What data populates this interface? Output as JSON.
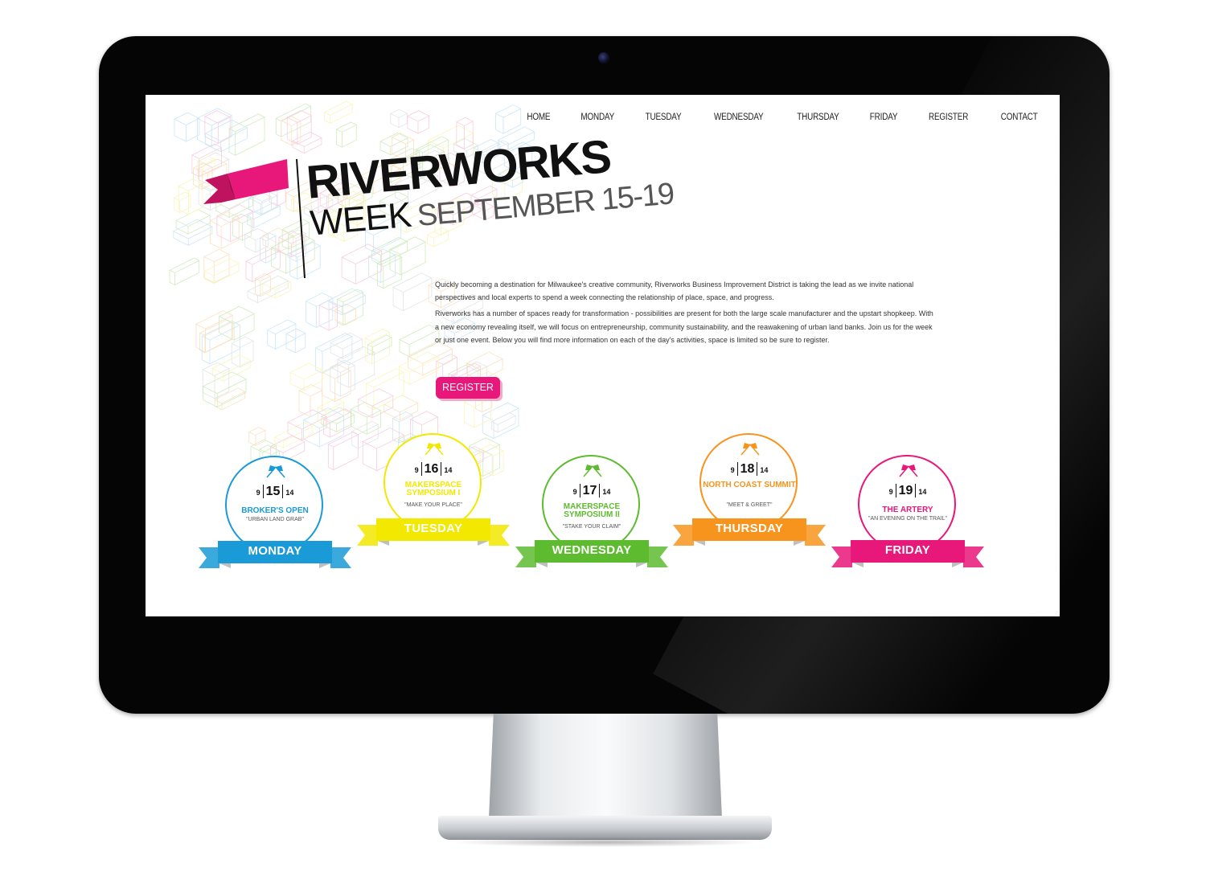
{
  "colors": {
    "monday": "#1a9ad7",
    "tuesday": "#f2e800",
    "wednesday": "#5dbb2f",
    "thursday": "#f7941d",
    "friday": "#e8177a",
    "accent_pink": "#e8177a"
  },
  "nav": {
    "items": [
      "HOME",
      "MONDAY",
      "TUESDAY",
      "WEDNESDAY",
      "THURSDAY",
      "FRIDAY",
      "REGISTER",
      "CONTACT"
    ]
  },
  "logo": {
    "title": "RIVERWORKS",
    "week": "WEEK",
    "dates": "SEPTEMBER 15-19",
    "flag_icon": "pink-ribbon-flag-icon"
  },
  "intro": {
    "paragraph_1": "Quickly becoming a destination for Milwaukee's creative community, Riverworks Business Improvement District is taking the lead as we invite national perspectives and local experts to spend a week connecting the relationship of place, space, and progress.",
    "paragraph_2": "Riverworks has a number of spaces ready for transformation - possibilities are present for both the large scale manufacturer and the upstart shopkeep. With a new economy revealing itself, we will focus on entrepreneurship, community sustainability, and the reawakening of urban land banks. Join us for the week or just one event. Below you will find more information on each of the day's activities, space is limited so be sure to register."
  },
  "register_button": {
    "label": "REGISTER"
  },
  "days": [
    {
      "month": "9",
      "day": "15",
      "year": "14",
      "event": "BROKER'S OPEN",
      "tagline": "\"URBAN LAND GRAB\"",
      "weekday": "MONDAY"
    },
    {
      "month": "9",
      "day": "16",
      "year": "14",
      "event": "MAKERSPACE SYMPOSIUM I",
      "tagline": "\"MAKE YOUR PLACE\"",
      "weekday": "TUESDAY"
    },
    {
      "month": "9",
      "day": "17",
      "year": "14",
      "event": "MAKERSPACE SYMPOSIUM II",
      "tagline": "\"STAKE YOUR CLAIM\"",
      "weekday": "WEDNESDAY"
    },
    {
      "month": "9",
      "day": "18",
      "year": "14",
      "event": "NORTH COAST SUMMIT",
      "tagline": "\"MEET & GREET\"",
      "weekday": "THURSDAY"
    },
    {
      "month": "9",
      "day": "19",
      "year": "14",
      "event": "THE ARTERY",
      "tagline": "\"AN EVENING ON THE TRAIL\"",
      "weekday": "FRIDAY"
    }
  ]
}
